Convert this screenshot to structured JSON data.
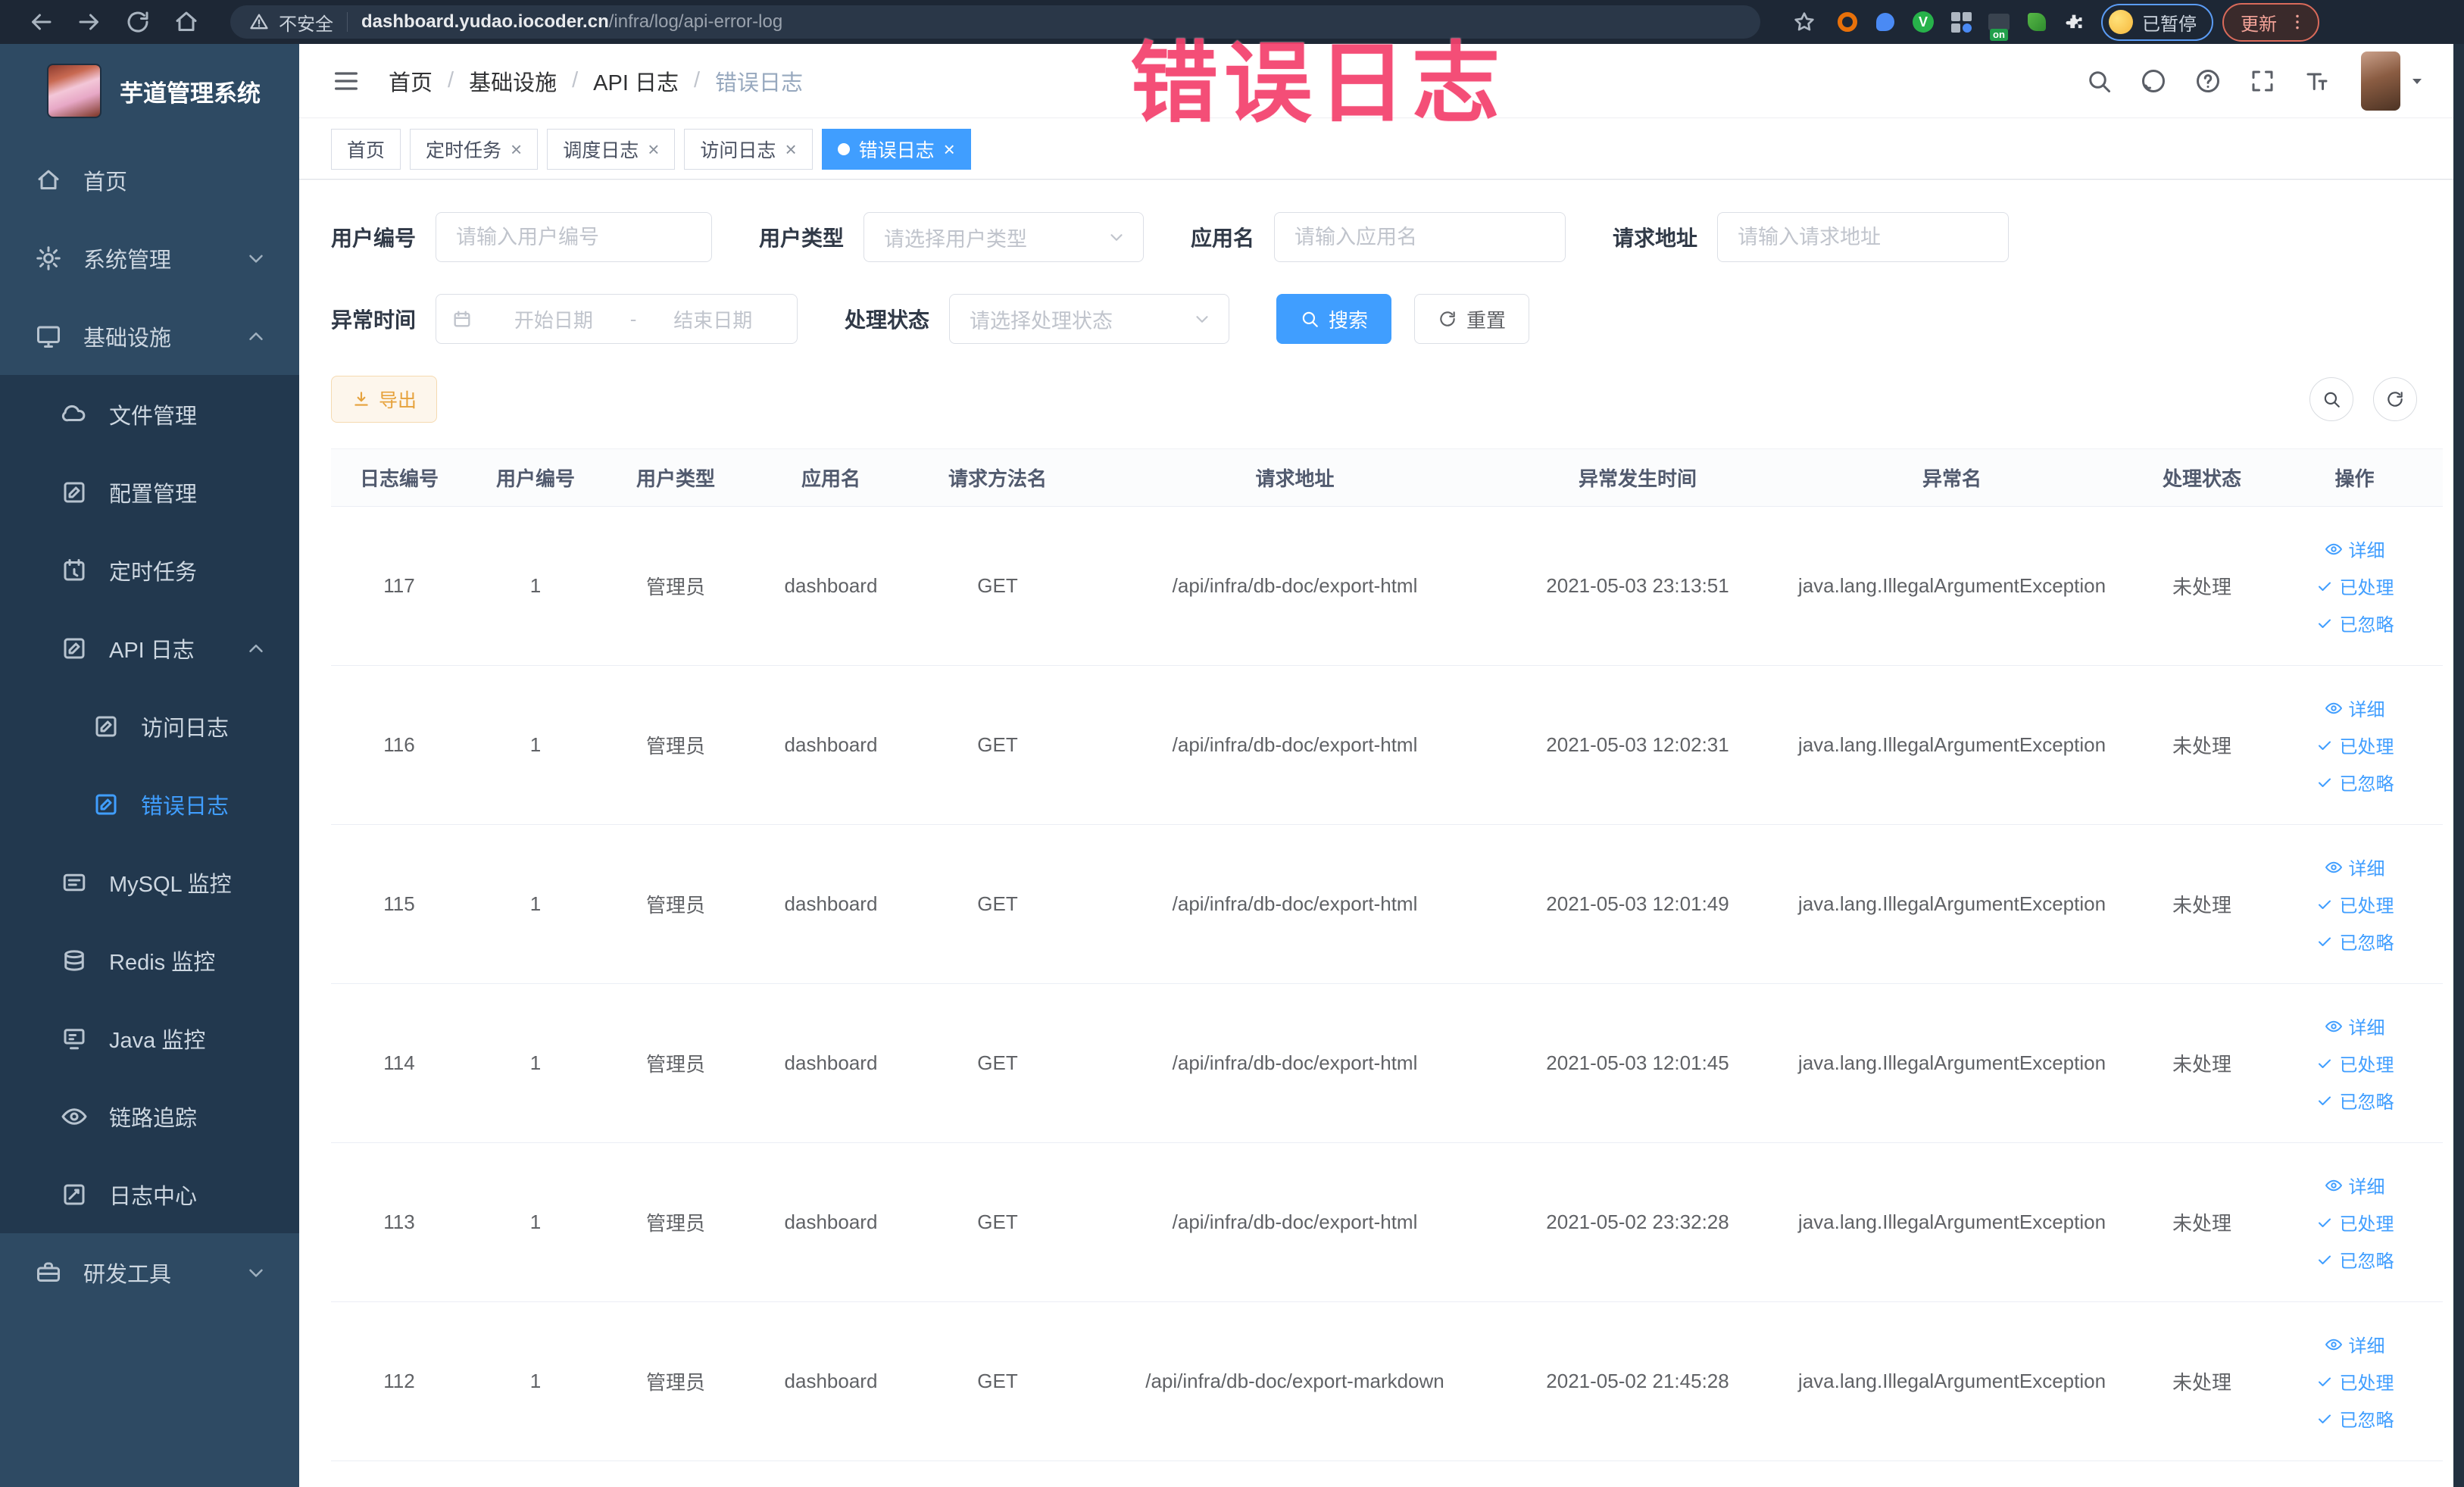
{
  "browser": {
    "security_label": "不安全",
    "url_domain": "dashboard.yudao.iocoder.cn",
    "url_path": "/infra/log/api-error-log",
    "paused_badge": "已暂停",
    "update_label": "更新",
    "extension_on_badge": "on"
  },
  "annotation": {
    "text": "错误日志",
    "color": "#f4416d"
  },
  "sidebar": {
    "title": "芋道管理系统",
    "items": [
      {
        "label": "首页",
        "icon": "home",
        "depth": "top",
        "chevron": null,
        "active": false
      },
      {
        "label": "系统管理",
        "icon": "gear",
        "depth": "top",
        "chevron": "down",
        "active": false
      },
      {
        "label": "基础设施",
        "icon": "monitor",
        "depth": "top",
        "chevron": "up",
        "active": false
      },
      {
        "label": "文件管理",
        "icon": "cloud",
        "depth": "sub",
        "chevron": null,
        "active": false
      },
      {
        "label": "配置管理",
        "icon": "edit",
        "depth": "sub",
        "chevron": null,
        "active": false
      },
      {
        "label": "定时任务",
        "icon": "timer",
        "depth": "sub",
        "chevron": null,
        "active": false
      },
      {
        "label": "API 日志",
        "icon": "apilog",
        "depth": "sub",
        "chevron": "up",
        "active": false
      },
      {
        "label": "访问日志",
        "icon": "doc",
        "depth": "subsub",
        "chevron": null,
        "active": false
      },
      {
        "label": "错误日志",
        "icon": "doc",
        "depth": "subsub",
        "chevron": null,
        "active": true
      },
      {
        "label": "MySQL 监控",
        "icon": "mysql",
        "depth": "sub",
        "chevron": null,
        "active": false
      },
      {
        "label": "Redis 监控",
        "icon": "redis",
        "depth": "sub",
        "chevron": null,
        "active": false
      },
      {
        "label": "Java 监控",
        "icon": "java",
        "depth": "sub",
        "chevron": null,
        "active": false
      },
      {
        "label": "链路追踪",
        "icon": "eye",
        "depth": "sub",
        "chevron": null,
        "active": false
      },
      {
        "label": "日志中心",
        "icon": "logcenter",
        "depth": "sub",
        "chevron": null,
        "active": false
      },
      {
        "label": "研发工具",
        "icon": "briefcase",
        "depth": "top",
        "chevron": "down",
        "active": false
      }
    ]
  },
  "header": {
    "breadcrumb": [
      "首页",
      "基础设施",
      "API 日志",
      "错误日志"
    ],
    "separator": "/"
  },
  "tags": [
    {
      "label": "首页",
      "closable": false,
      "active": false
    },
    {
      "label": "定时任务",
      "closable": true,
      "active": false
    },
    {
      "label": "调度日志",
      "closable": true,
      "active": false
    },
    {
      "label": "访问日志",
      "closable": true,
      "active": false
    },
    {
      "label": "错误日志",
      "closable": true,
      "active": true
    }
  ],
  "filters": {
    "user_id": {
      "label": "用户编号",
      "placeholder": "请输入用户编号"
    },
    "user_type": {
      "label": "用户类型",
      "placeholder": "请选择用户类型"
    },
    "app_name": {
      "label": "应用名",
      "placeholder": "请输入应用名"
    },
    "request_url": {
      "label": "请求地址",
      "placeholder": "请输入请求地址"
    },
    "exception_time": {
      "label": "异常时间",
      "start_placeholder": "开始日期",
      "separator": "-",
      "end_placeholder": "结束日期"
    },
    "process_status": {
      "label": "处理状态",
      "placeholder": "请选择处理状态"
    },
    "search_label": "搜索",
    "reset_label": "重置"
  },
  "toolbar": {
    "export_label": "导出"
  },
  "table": {
    "headers": [
      "日志编号",
      "用户编号",
      "用户类型",
      "应用名",
      "请求方法名",
      "请求地址",
      "异常发生时间",
      "异常名",
      "处理状态",
      "操作"
    ],
    "actions": [
      "详细",
      "已处理",
      "已忽略"
    ],
    "rows": [
      {
        "id": "117",
        "user_id": "1",
        "user_type": "管理员",
        "app": "dashboard",
        "method": "GET",
        "url": "/api/infra/db-doc/export-html",
        "time": "2021-05-03 23:13:51",
        "exception": "java.lang.IllegalArgumentException",
        "status": "未处理"
      },
      {
        "id": "116",
        "user_id": "1",
        "user_type": "管理员",
        "app": "dashboard",
        "method": "GET",
        "url": "/api/infra/db-doc/export-html",
        "time": "2021-05-03 12:02:31",
        "exception": "java.lang.IllegalArgumentException",
        "status": "未处理"
      },
      {
        "id": "115",
        "user_id": "1",
        "user_type": "管理员",
        "app": "dashboard",
        "method": "GET",
        "url": "/api/infra/db-doc/export-html",
        "time": "2021-05-03 12:01:49",
        "exception": "java.lang.IllegalArgumentException",
        "status": "未处理"
      },
      {
        "id": "114",
        "user_id": "1",
        "user_type": "管理员",
        "app": "dashboard",
        "method": "GET",
        "url": "/api/infra/db-doc/export-html",
        "time": "2021-05-03 12:01:45",
        "exception": "java.lang.IllegalArgumentException",
        "status": "未处理"
      },
      {
        "id": "113",
        "user_id": "1",
        "user_type": "管理员",
        "app": "dashboard",
        "method": "GET",
        "url": "/api/infra/db-doc/export-html",
        "time": "2021-05-02 23:32:28",
        "exception": "java.lang.IllegalArgumentException",
        "status": "未处理"
      },
      {
        "id": "112",
        "user_id": "1",
        "user_type": "管理员",
        "app": "dashboard",
        "method": "GET",
        "url": "/api/infra/db-doc/export-markdown",
        "time": "2021-05-02 21:45:28",
        "exception": "java.lang.IllegalArgumentException",
        "status": "未处理"
      }
    ]
  }
}
